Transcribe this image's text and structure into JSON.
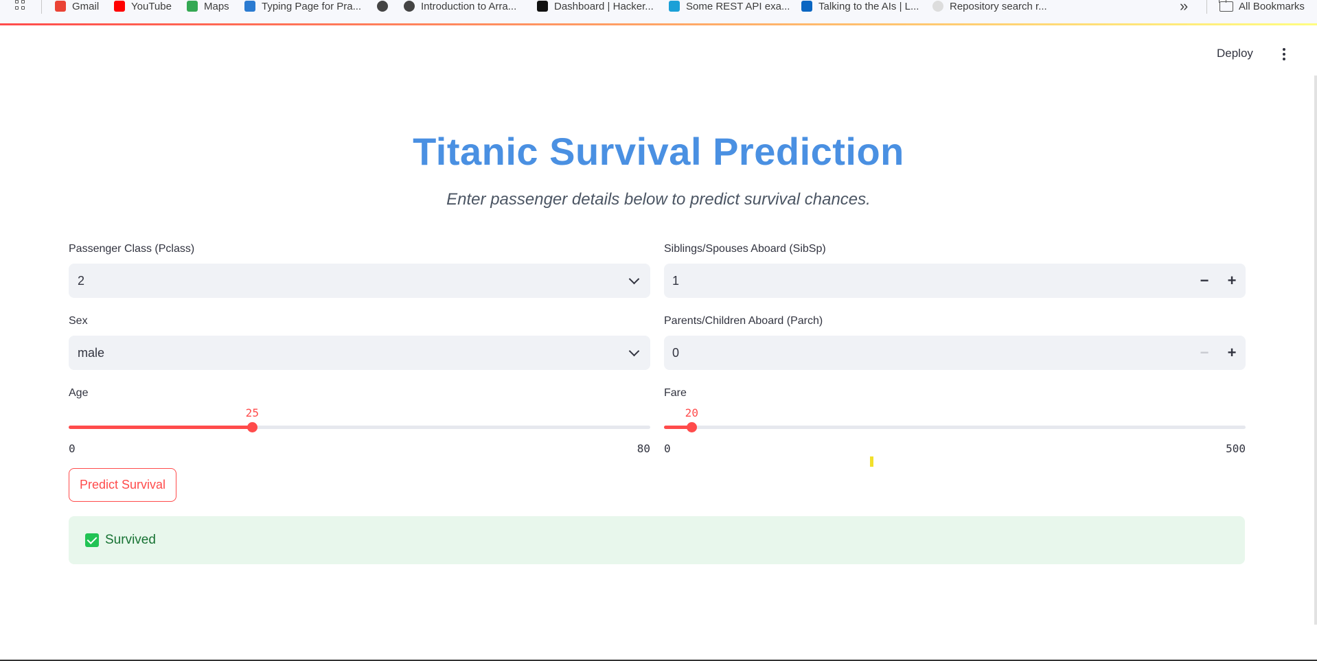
{
  "bookmarks": [
    {
      "label": "Gmail",
      "icon": "gmail-icon",
      "color": "#ea4335"
    },
    {
      "label": "YouTube",
      "icon": "youtube-icon",
      "color": "#ff0000"
    },
    {
      "label": "Maps",
      "icon": "maps-icon",
      "color": "#34a853"
    },
    {
      "label": "Typing Page for Pra...",
      "icon": "typing-icon",
      "color": "#2b7bd1"
    },
    {
      "label": "",
      "icon": "globe-icon",
      "color": "#444444"
    },
    {
      "label": "Introduction to Arra...",
      "icon": "globe-icon",
      "color": "#444444"
    },
    {
      "label": "Dashboard | Hacker...",
      "icon": "hackerrank-icon",
      "color": "#111111"
    },
    {
      "label": "Some REST API exa...",
      "icon": "cisco-icon",
      "color": "#1ba0d7"
    },
    {
      "label": "Talking to the AIs | L...",
      "icon": "video-icon",
      "color": "#0a66c2"
    },
    {
      "label": "Repository search r...",
      "icon": "github-icon",
      "color": "#dddddd"
    }
  ],
  "bookmarks_all": "All Bookmarks",
  "header": {
    "deploy": "Deploy"
  },
  "title": "Titanic Survival Prediction",
  "subtitle": "Enter passenger details below to predict survival chances.",
  "pclass": {
    "label": "Passenger Class (Pclass)",
    "value": "2"
  },
  "sex": {
    "label": "Sex",
    "value": "male"
  },
  "sibsp": {
    "label": "Siblings/Spouses Aboard (SibSp)",
    "value": "1"
  },
  "parch": {
    "label": "Parents/Children Aboard (Parch)",
    "value": "0"
  },
  "age": {
    "label": "Age",
    "value": 25,
    "min": 0,
    "max": 80
  },
  "fare": {
    "label": "Fare",
    "value": 20,
    "min": 0,
    "max": 500
  },
  "predict_button": "Predict Survival",
  "result": {
    "text": "Survived",
    "color": "#21c354"
  },
  "accent": "#ff4b4b",
  "title_color": "#4a90e2"
}
